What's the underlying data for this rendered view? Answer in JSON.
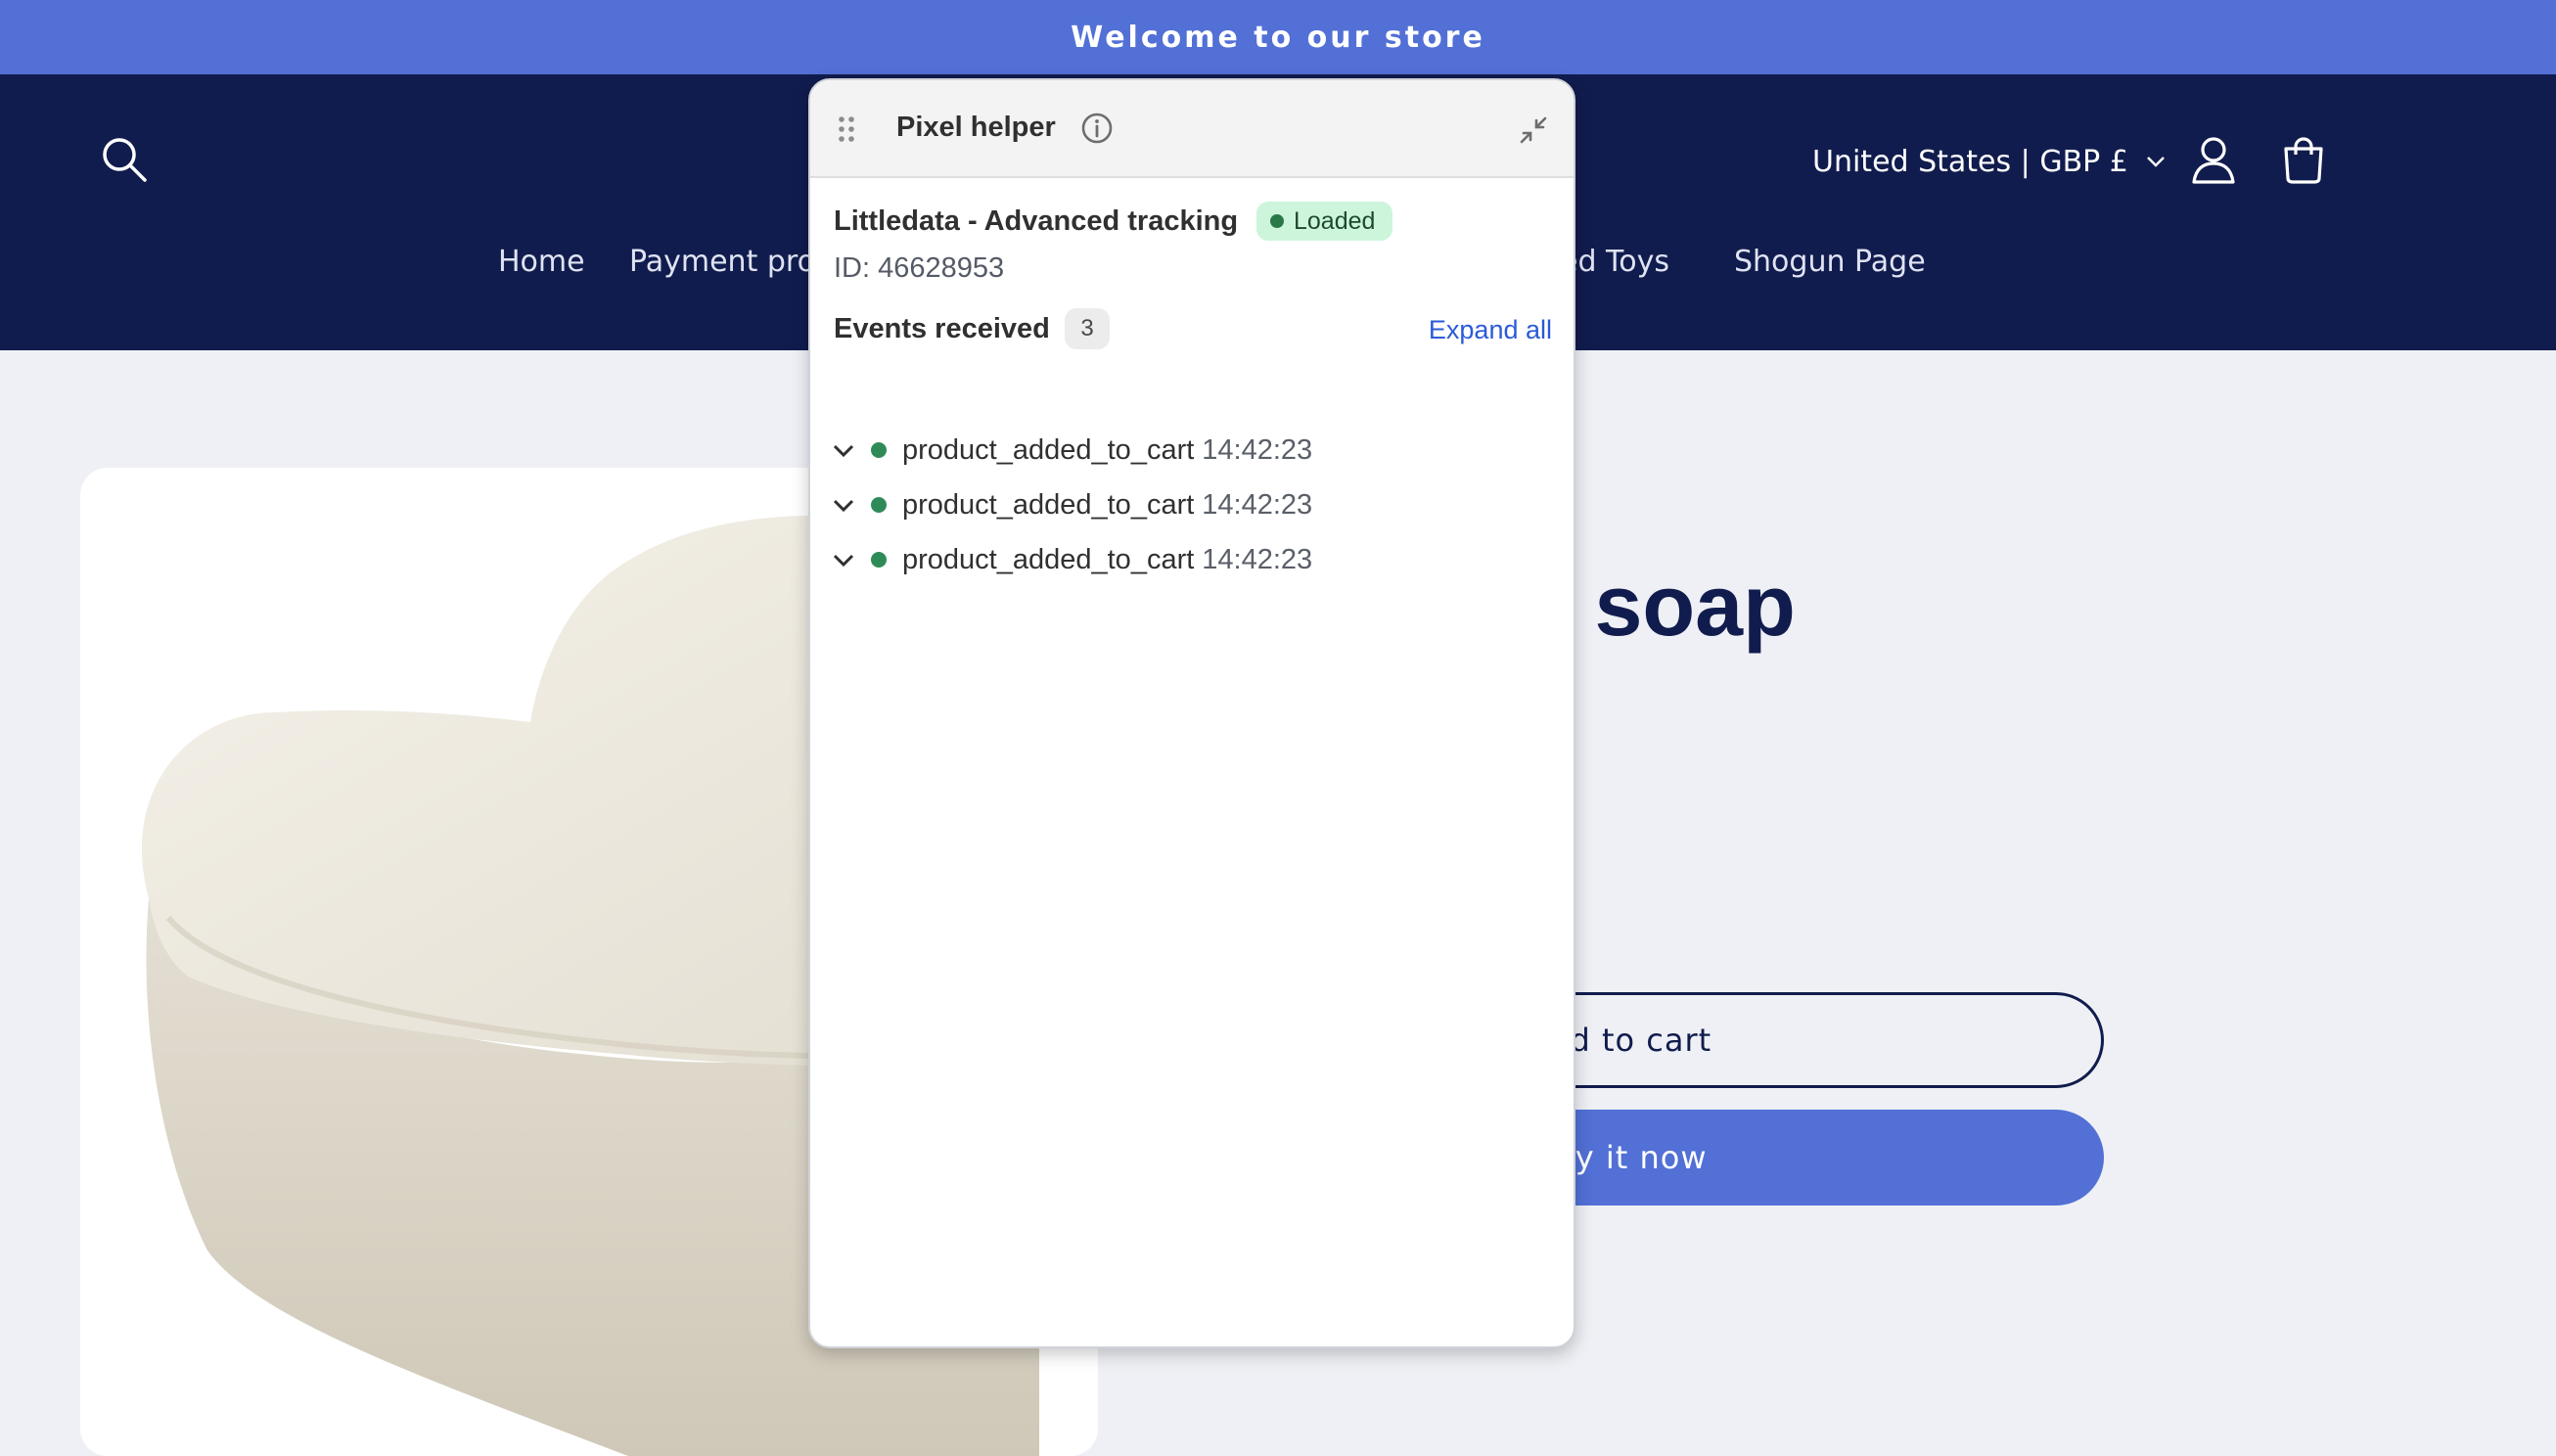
{
  "announcement": {
    "text": "Welcome to our store"
  },
  "header": {
    "country_selector": "United States | GBP £",
    "nav": [
      {
        "label": "Home"
      },
      {
        "label": "Payment pro"
      },
      {
        "label": "ed Toys"
      },
      {
        "label": "Shogun Page"
      }
    ]
  },
  "product": {
    "title": "art shaped soap",
    "add_to_cart": "Add to cart",
    "buy_now": "Buy it now"
  },
  "pixel_helper": {
    "title": "Pixel helper",
    "pixel_name": "Littledata - Advanced tracking",
    "status": "Loaded",
    "pixel_id": "ID: 46628953",
    "events_label": "Events received",
    "events_count": "3",
    "expand_all": "Expand all",
    "events": [
      {
        "name": "product_added_to_cart",
        "time": "14:42:23"
      },
      {
        "name": "product_added_to_cart",
        "time": "14:42:23"
      },
      {
        "name": "product_added_to_cart",
        "time": "14:42:23"
      }
    ]
  },
  "colors": {
    "announcement_bg": "#5270d6",
    "header_bg": "#111c4e",
    "page_bg": "#eef0f5",
    "status_badge_bg": "#cdf5dc",
    "link_blue": "#2a5bd7"
  }
}
